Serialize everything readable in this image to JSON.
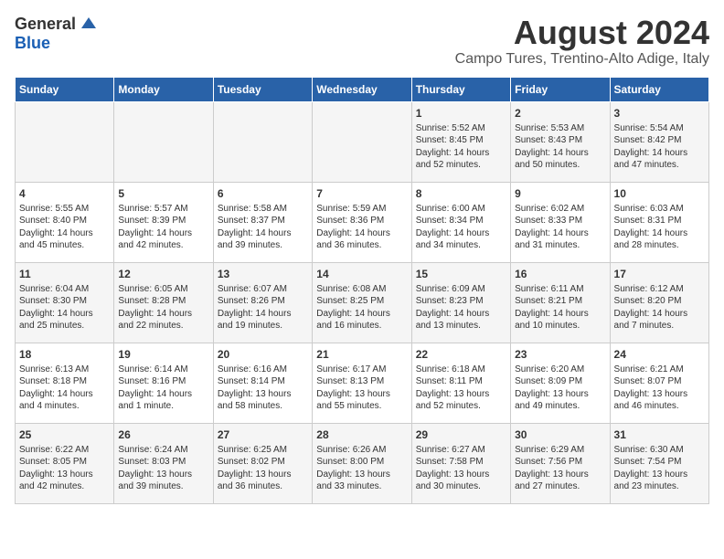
{
  "logo": {
    "general": "General",
    "blue": "Blue"
  },
  "title": "August 2024",
  "subtitle": "Campo Tures, Trentino-Alto Adige, Italy",
  "weekdays": [
    "Sunday",
    "Monday",
    "Tuesday",
    "Wednesday",
    "Thursday",
    "Friday",
    "Saturday"
  ],
  "weeks": [
    [
      {
        "day": "",
        "info": ""
      },
      {
        "day": "",
        "info": ""
      },
      {
        "day": "",
        "info": ""
      },
      {
        "day": "",
        "info": ""
      },
      {
        "day": "1",
        "info": "Sunrise: 5:52 AM\nSunset: 8:45 PM\nDaylight: 14 hours\nand 52 minutes."
      },
      {
        "day": "2",
        "info": "Sunrise: 5:53 AM\nSunset: 8:43 PM\nDaylight: 14 hours\nand 50 minutes."
      },
      {
        "day": "3",
        "info": "Sunrise: 5:54 AM\nSunset: 8:42 PM\nDaylight: 14 hours\nand 47 minutes."
      }
    ],
    [
      {
        "day": "4",
        "info": "Sunrise: 5:55 AM\nSunset: 8:40 PM\nDaylight: 14 hours\nand 45 minutes."
      },
      {
        "day": "5",
        "info": "Sunrise: 5:57 AM\nSunset: 8:39 PM\nDaylight: 14 hours\nand 42 minutes."
      },
      {
        "day": "6",
        "info": "Sunrise: 5:58 AM\nSunset: 8:37 PM\nDaylight: 14 hours\nand 39 minutes."
      },
      {
        "day": "7",
        "info": "Sunrise: 5:59 AM\nSunset: 8:36 PM\nDaylight: 14 hours\nand 36 minutes."
      },
      {
        "day": "8",
        "info": "Sunrise: 6:00 AM\nSunset: 8:34 PM\nDaylight: 14 hours\nand 34 minutes."
      },
      {
        "day": "9",
        "info": "Sunrise: 6:02 AM\nSunset: 8:33 PM\nDaylight: 14 hours\nand 31 minutes."
      },
      {
        "day": "10",
        "info": "Sunrise: 6:03 AM\nSunset: 8:31 PM\nDaylight: 14 hours\nand 28 minutes."
      }
    ],
    [
      {
        "day": "11",
        "info": "Sunrise: 6:04 AM\nSunset: 8:30 PM\nDaylight: 14 hours\nand 25 minutes."
      },
      {
        "day": "12",
        "info": "Sunrise: 6:05 AM\nSunset: 8:28 PM\nDaylight: 14 hours\nand 22 minutes."
      },
      {
        "day": "13",
        "info": "Sunrise: 6:07 AM\nSunset: 8:26 PM\nDaylight: 14 hours\nand 19 minutes."
      },
      {
        "day": "14",
        "info": "Sunrise: 6:08 AM\nSunset: 8:25 PM\nDaylight: 14 hours\nand 16 minutes."
      },
      {
        "day": "15",
        "info": "Sunrise: 6:09 AM\nSunset: 8:23 PM\nDaylight: 14 hours\nand 13 minutes."
      },
      {
        "day": "16",
        "info": "Sunrise: 6:11 AM\nSunset: 8:21 PM\nDaylight: 14 hours\nand 10 minutes."
      },
      {
        "day": "17",
        "info": "Sunrise: 6:12 AM\nSunset: 8:20 PM\nDaylight: 14 hours\nand 7 minutes."
      }
    ],
    [
      {
        "day": "18",
        "info": "Sunrise: 6:13 AM\nSunset: 8:18 PM\nDaylight: 14 hours\nand 4 minutes."
      },
      {
        "day": "19",
        "info": "Sunrise: 6:14 AM\nSunset: 8:16 PM\nDaylight: 14 hours\nand 1 minute."
      },
      {
        "day": "20",
        "info": "Sunrise: 6:16 AM\nSunset: 8:14 PM\nDaylight: 13 hours\nand 58 minutes."
      },
      {
        "day": "21",
        "info": "Sunrise: 6:17 AM\nSunset: 8:13 PM\nDaylight: 13 hours\nand 55 minutes."
      },
      {
        "day": "22",
        "info": "Sunrise: 6:18 AM\nSunset: 8:11 PM\nDaylight: 13 hours\nand 52 minutes."
      },
      {
        "day": "23",
        "info": "Sunrise: 6:20 AM\nSunset: 8:09 PM\nDaylight: 13 hours\nand 49 minutes."
      },
      {
        "day": "24",
        "info": "Sunrise: 6:21 AM\nSunset: 8:07 PM\nDaylight: 13 hours\nand 46 minutes."
      }
    ],
    [
      {
        "day": "25",
        "info": "Sunrise: 6:22 AM\nSunset: 8:05 PM\nDaylight: 13 hours\nand 42 minutes."
      },
      {
        "day": "26",
        "info": "Sunrise: 6:24 AM\nSunset: 8:03 PM\nDaylight: 13 hours\nand 39 minutes."
      },
      {
        "day": "27",
        "info": "Sunrise: 6:25 AM\nSunset: 8:02 PM\nDaylight: 13 hours\nand 36 minutes."
      },
      {
        "day": "28",
        "info": "Sunrise: 6:26 AM\nSunset: 8:00 PM\nDaylight: 13 hours\nand 33 minutes."
      },
      {
        "day": "29",
        "info": "Sunrise: 6:27 AM\nSunset: 7:58 PM\nDaylight: 13 hours\nand 30 minutes."
      },
      {
        "day": "30",
        "info": "Sunrise: 6:29 AM\nSunset: 7:56 PM\nDaylight: 13 hours\nand 27 minutes."
      },
      {
        "day": "31",
        "info": "Sunrise: 6:30 AM\nSunset: 7:54 PM\nDaylight: 13 hours\nand 23 minutes."
      }
    ]
  ]
}
